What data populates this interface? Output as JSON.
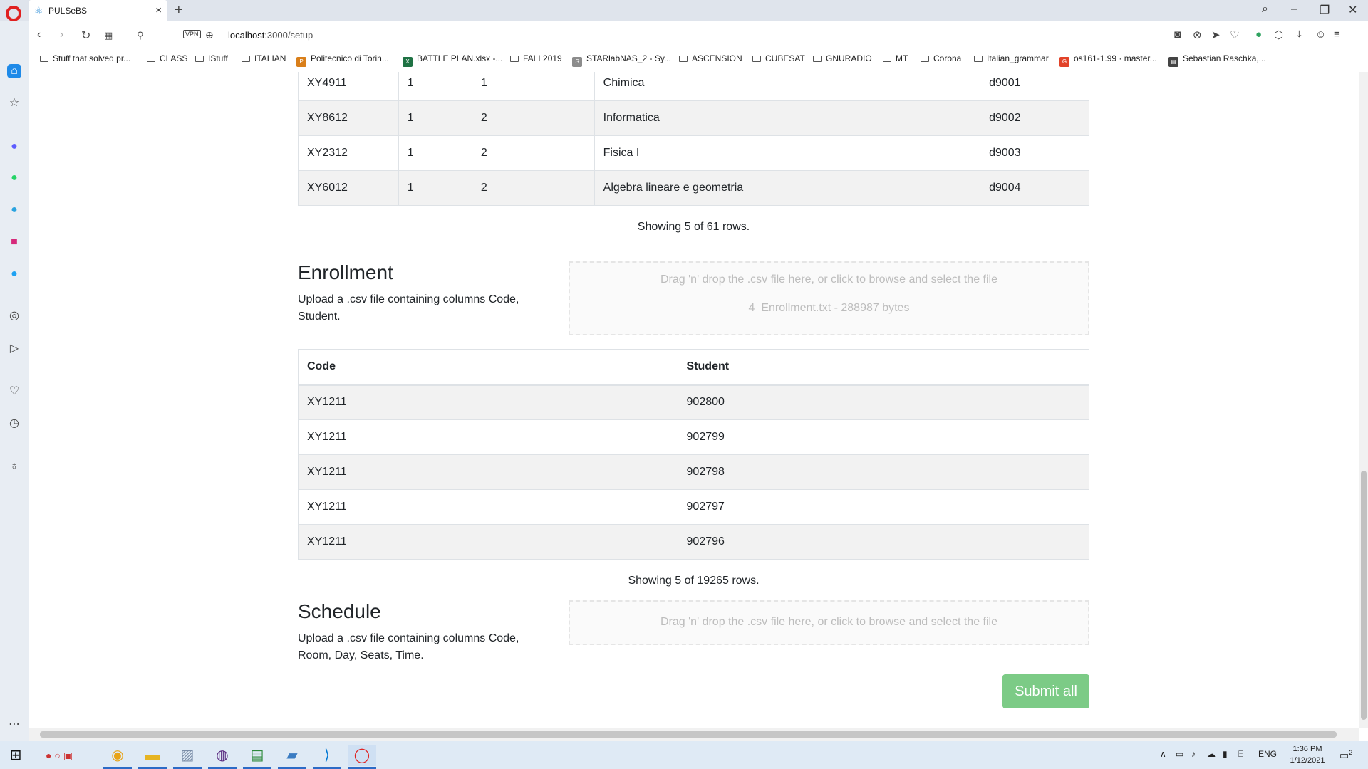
{
  "browser": {
    "tab_title": "PULSeBS",
    "url_host": "localhost",
    "url_path": ":3000/setup",
    "vpn_label": "VPN",
    "bookmarks": [
      {
        "label": "Stuff that solved pr...",
        "type": "folder"
      },
      {
        "label": "CLASS",
        "type": "folder"
      },
      {
        "label": "IStuff",
        "type": "folder"
      },
      {
        "label": "ITALIAN",
        "type": "folder"
      },
      {
        "label": "Politecnico di Torin...",
        "type": "site"
      },
      {
        "label": "BATTLE PLAN.xlsx -...",
        "type": "excel"
      },
      {
        "label": "FALL2019",
        "type": "folder"
      },
      {
        "label": "STARlabNAS_2 - Sy...",
        "type": "site"
      },
      {
        "label": "ASCENSION",
        "type": "folder"
      },
      {
        "label": "CUBESAT",
        "type": "folder"
      },
      {
        "label": "GNURADIO",
        "type": "folder"
      },
      {
        "label": "MT",
        "type": "folder"
      },
      {
        "label": "Corona",
        "type": "folder"
      },
      {
        "label": "Italian_grammar",
        "type": "folder"
      },
      {
        "label": "os161-1.99 · master...",
        "type": "gitlab"
      },
      {
        "label": "Sebastian Raschka,...",
        "type": "doc"
      }
    ]
  },
  "courses_table": {
    "rows": [
      [
        "XY4911",
        "1",
        "1",
        "Chimica",
        "d9001"
      ],
      [
        "XY8612",
        "1",
        "2",
        "Informatica",
        "d9002"
      ],
      [
        "XY2312",
        "1",
        "2",
        "Fisica I",
        "d9003"
      ],
      [
        "XY6012",
        "1",
        "2",
        "Algebra lineare e geometria",
        "d9004"
      ]
    ],
    "count_text": "Showing 5 of 61 rows."
  },
  "enrollment": {
    "title": "Enrollment",
    "description": "Upload a .csv file containing columns Code, Student.",
    "dropzone_text": "Drag 'n' drop the .csv file here, or click to browse and select the file",
    "file_info": "4_Enrollment.txt - 288987 bytes",
    "headers": [
      "Code",
      "Student"
    ],
    "rows": [
      [
        "XY1211",
        "902800"
      ],
      [
        "XY1211",
        "902799"
      ],
      [
        "XY1211",
        "902798"
      ],
      [
        "XY1211",
        "902797"
      ],
      [
        "XY1211",
        "902796"
      ]
    ],
    "count_text": "Showing 5 of 19265 rows."
  },
  "schedule": {
    "title": "Schedule",
    "description": "Upload a .csv file containing columns Code, Room, Day, Seats, Time.",
    "dropzone_text": "Drag 'n' drop the .csv file here, or click to browse and select the file"
  },
  "submit_label": "Submit all",
  "taskbar": {
    "lang": "ENG",
    "time": "1:36 PM",
    "date": "1/12/2021",
    "notification_count": "2"
  },
  "colors": {
    "submit_bg": "#7ccb86",
    "stripe": "#f2f2f2",
    "opera_red": "#e0201f"
  }
}
